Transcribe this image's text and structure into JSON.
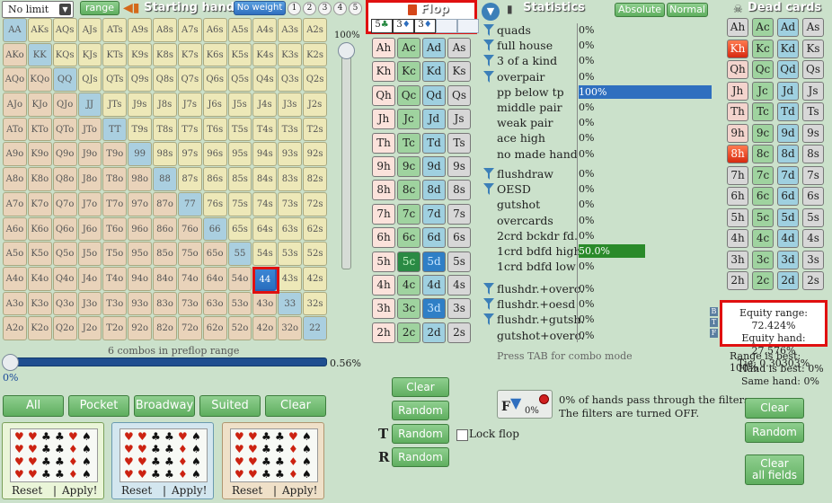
{
  "colors": {
    "accent_green": "#5fae5f",
    "selected_blue": "#2a6fbf",
    "highlight_red": "#e01010",
    "pair": "#aacfe0",
    "suited": "#ede8b8",
    "offsuit": "#e9d3ba"
  },
  "top": {
    "limit_select": "No limit",
    "range_button": "range",
    "starting_hand_title": "Starting hand",
    "weight_button": "No weight",
    "weights": [
      "1",
      "2",
      "3",
      "4",
      "5"
    ]
  },
  "hand_grid": {
    "rows": [
      [
        "AA",
        "AKs",
        "AQs",
        "AJs",
        "ATs",
        "A9s",
        "A8s",
        "A7s",
        "A6s",
        "A5s",
        "A4s",
        "A3s",
        "A2s"
      ],
      [
        "AKo",
        "KK",
        "KQs",
        "KJs",
        "KTs",
        "K9s",
        "K8s",
        "K7s",
        "K6s",
        "K5s",
        "K4s",
        "K3s",
        "K2s"
      ],
      [
        "AQo",
        "KQo",
        "QQ",
        "QJs",
        "QTs",
        "Q9s",
        "Q8s",
        "Q7s",
        "Q6s",
        "Q5s",
        "Q4s",
        "Q3s",
        "Q2s"
      ],
      [
        "AJo",
        "KJo",
        "QJo",
        "JJ",
        "JTs",
        "J9s",
        "J8s",
        "J7s",
        "J6s",
        "J5s",
        "J4s",
        "J3s",
        "J2s"
      ],
      [
        "ATo",
        "KTo",
        "QTo",
        "JTo",
        "TT",
        "T9s",
        "T8s",
        "T7s",
        "T6s",
        "T5s",
        "T4s",
        "T3s",
        "T2s"
      ],
      [
        "A9o",
        "K9o",
        "Q9o",
        "J9o",
        "T9o",
        "99",
        "98s",
        "97s",
        "96s",
        "95s",
        "94s",
        "93s",
        "92s"
      ],
      [
        "A8o",
        "K8o",
        "Q8o",
        "J8o",
        "T8o",
        "98o",
        "88",
        "87s",
        "86s",
        "85s",
        "84s",
        "83s",
        "82s"
      ],
      [
        "A7o",
        "K7o",
        "Q7o",
        "J7o",
        "T7o",
        "97o",
        "87o",
        "77",
        "76s",
        "75s",
        "74s",
        "73s",
        "72s"
      ],
      [
        "A6o",
        "K6o",
        "Q6o",
        "J6o",
        "T6o",
        "96o",
        "86o",
        "76o",
        "66",
        "65s",
        "64s",
        "63s",
        "62s"
      ],
      [
        "A5o",
        "K5o",
        "Q5o",
        "J5o",
        "T5o",
        "95o",
        "85o",
        "75o",
        "65o",
        "55",
        "54s",
        "53s",
        "52s"
      ],
      [
        "A4o",
        "K4o",
        "Q4o",
        "J4o",
        "T4o",
        "94o",
        "84o",
        "74o",
        "64o",
        "54o",
        "44",
        "43s",
        "42s"
      ],
      [
        "A3o",
        "K3o",
        "Q3o",
        "J3o",
        "T3o",
        "93o",
        "83o",
        "73o",
        "63o",
        "53o",
        "43o",
        "33",
        "32s"
      ],
      [
        "A2o",
        "K2o",
        "Q2o",
        "J2o",
        "T2o",
        "92o",
        "82o",
        "72o",
        "62o",
        "52o",
        "42o",
        "32o",
        "22"
      ]
    ],
    "selected": "44"
  },
  "vslider": {
    "label": "100%",
    "value": 1.0
  },
  "combos": {
    "label": "6 combos in preflop range"
  },
  "hslider": {
    "left_label": "0%",
    "right_label": "0.56%",
    "value": 0.0056
  },
  "filter_buttons": [
    "All",
    "Pocket",
    "Broadway",
    "Suited",
    "Clear"
  ],
  "presets": [
    {
      "reset": "Reset",
      "apply": "Apply!"
    },
    {
      "reset": "Reset",
      "apply": "Apply!"
    },
    {
      "reset": "Reset",
      "apply": "Apply!"
    }
  ],
  "flop": {
    "title": "Flop",
    "cards": [
      {
        "rank": "5",
        "suit": "♣"
      },
      {
        "rank": "3",
        "suit": "♦"
      },
      {
        "rank": "3",
        "suit": "♦"
      }
    ],
    "ranks": [
      "A",
      "K",
      "Q",
      "J",
      "T",
      "9",
      "8",
      "7",
      "6",
      "5",
      "4",
      "3",
      "2"
    ],
    "suits": [
      "h",
      "c",
      "d",
      "s"
    ],
    "clear_button": "Clear",
    "random_buttons": [
      "Random",
      "Random",
      "Random"
    ],
    "t_label": "T",
    "r_label": "R",
    "lock_flop": "Lock flop"
  },
  "stats": {
    "title": "Statistics",
    "absolute": "Absolute",
    "normal": "Normal",
    "groups": [
      [
        {
          "label": "quads",
          "pct": "0%",
          "filter": true
        },
        {
          "label": "full house",
          "pct": "0%",
          "filter": true
        },
        {
          "label": "3 of a kind",
          "pct": "0%",
          "filter": true
        },
        {
          "label": "overpair",
          "pct": "0%",
          "filter": true
        },
        {
          "label": "pp below tp",
          "pct": "100%",
          "filter": false,
          "bar": 1.0
        },
        {
          "label": "middle pair",
          "pct": "0%",
          "filter": false
        },
        {
          "label": "weak pair",
          "pct": "0%",
          "filter": false
        },
        {
          "label": "ace high",
          "pct": "0%",
          "filter": false
        },
        {
          "label": "no made hand",
          "pct": "0%",
          "filter": false
        }
      ],
      [
        {
          "label": "flushdraw",
          "pct": "0%",
          "filter": true
        },
        {
          "label": "OESD",
          "pct": "0%",
          "filter": true
        },
        {
          "label": "gutshot",
          "pct": "0%",
          "filter": false
        },
        {
          "label": "overcards",
          "pct": "0%",
          "filter": false
        },
        {
          "label": "2crd bckdr fd.",
          "pct": "0%",
          "filter": false
        },
        {
          "label": "1crd bdfd high",
          "pct": "50.0%",
          "filter": false,
          "bar": 0.5
        },
        {
          "label": "1crd bdfd low",
          "pct": "0%",
          "filter": false
        }
      ],
      [
        {
          "label": "flushdr.+overc.",
          "pct": "0%",
          "filter": true
        },
        {
          "label": "flushdr.+oesd",
          "pct": "0%",
          "filter": true
        },
        {
          "label": "flushdr.+gutsh.",
          "pct": "0%",
          "filter": true
        },
        {
          "label": "gutshot+overc.",
          "pct": "0%",
          "filter": false
        }
      ]
    ],
    "tab_hint": "Press TAB for combo mode",
    "filter_box_pct": "0%",
    "filter_box_letter": "F",
    "filter_text1": "0% of hands pass through the filters.",
    "filter_text2": "The filters are turned OFF."
  },
  "dead": {
    "title": "Dead cards",
    "ranks": [
      "A",
      "K",
      "Q",
      "J",
      "T",
      "9",
      "8",
      "7",
      "6",
      "5",
      "4",
      "3",
      "2"
    ],
    "hearts_state": [
      "normal",
      "selected",
      "light",
      "light",
      "light",
      "light",
      "selected",
      "normal",
      "normal",
      "normal",
      "normal",
      "normal",
      "normal"
    ],
    "side_letters": [
      "B",
      "T",
      "F"
    ],
    "equity_range": "Equity range: 72.424%",
    "equity_hand": "Equity hand: 27.576%",
    "tie": "Tie: 0.30303%",
    "range_best": "Range is best: 100%",
    "hand_best": "Hand is best: 0%",
    "same_hand": "Same hand: 0%",
    "clear_button": "Clear",
    "random_button": "Random",
    "clear_all_line1": "Clear",
    "clear_all_line2": "all fields"
  }
}
